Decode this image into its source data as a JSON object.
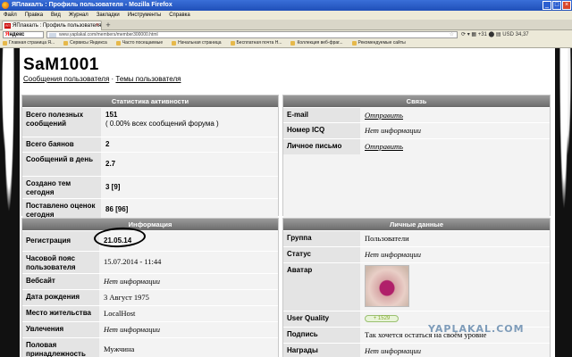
{
  "browser": {
    "window_title": "ЯПлакалъ : Профиль пользователя - Mozilla Firefox",
    "window_buttons": [
      "_",
      "□",
      "×"
    ],
    "menu": [
      "Файл",
      "Правка",
      "Вид",
      "Журнал",
      "Закладки",
      "Инструменты",
      "Справка"
    ],
    "tab_label": "ЯПлакалъ : Профиль пользователя",
    "tab_favicon": "ЯП",
    "tab_close": "×",
    "new_tab": "+",
    "yandex_ya": "Я",
    "yandex_rest": "ндекс",
    "url": "www.yaplakal.com/members/member300000.html",
    "url_star": "☆",
    "nav_extras": "⟳ ▾   ▦ +31   ⬤ ▤ USD 34,37",
    "bookmarks": [
      "Главная страница Я...",
      "Сервисы Яндекса",
      "Часто посещаемые",
      "Начальная страница",
      "Бесплатная почта H...",
      "Коллекция веб-фраг...",
      "Рекомендуемые сайты"
    ]
  },
  "profile": {
    "username": "SaM1001",
    "link_messages": "Сообщения пользователя",
    "separator": " · ",
    "link_topics": "Темы пользователя"
  },
  "stats": {
    "heading": "Статистика активности",
    "rows": [
      {
        "label": "Всего полезных сообщений",
        "value": "151",
        "sub": "( 0.00% всех сообщений форума )"
      },
      {
        "label": "Всего баянов",
        "value": "2"
      },
      {
        "label": "Сообщений в день",
        "value": "2.7"
      },
      {
        "label": "Создано тем сегодня",
        "value": "3 [9]"
      },
      {
        "label": "Поставлено оценок сегодня",
        "value": "86 [96]"
      }
    ]
  },
  "contact": {
    "heading": "Связь",
    "rows": [
      {
        "label": "E-mail",
        "value": "Отправить"
      },
      {
        "label": "Номер ICQ",
        "value": "Нет информации"
      },
      {
        "label": "Личное письмо",
        "value": "Отправить"
      }
    ]
  },
  "info": {
    "heading": "Информация",
    "rows": [
      {
        "label": "Регистрация",
        "value": "21.05.14"
      },
      {
        "label": "Часовой пояс пользователя",
        "value": "15.07.2014 - 11:44"
      },
      {
        "label": "Вебсайт",
        "value": "Нет информации"
      },
      {
        "label": "Дата рождения",
        "value": "3 Август 1975"
      },
      {
        "label": "Место жительства",
        "value": "LocalHost"
      },
      {
        "label": "Увлечения",
        "value": "Нет информации"
      },
      {
        "label": "Половая принадлежность",
        "value": "Мужчина"
      }
    ]
  },
  "personal": {
    "heading": "Личные данные",
    "rows": [
      {
        "label": "Группа",
        "value": "Пользователи"
      },
      {
        "label": "Статус",
        "value": "Нет информации"
      },
      {
        "label": "Аватар",
        "value": ""
      },
      {
        "label": "User Quality",
        "value": "1529",
        "prefix": "+"
      },
      {
        "label": "Подпись",
        "value": "Так хочется остаться на своём уровне"
      },
      {
        "label": "Награды",
        "value": "Нет информации"
      }
    ]
  },
  "watermark": "YAPLAKAL.COM"
}
